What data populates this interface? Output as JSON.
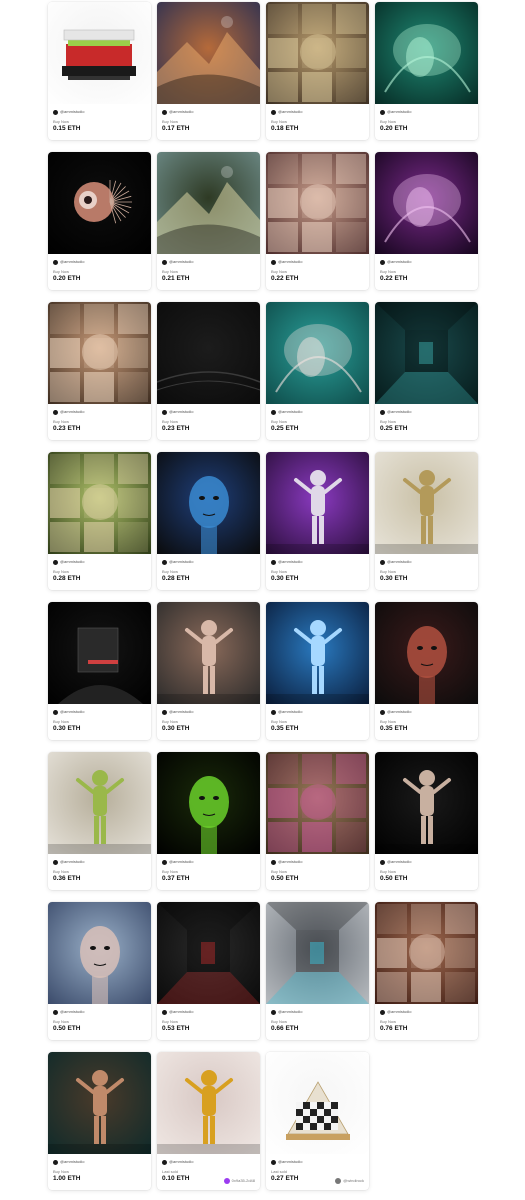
{
  "labels": {
    "buy_now": "Buy Now",
    "last_sold": "Last sold"
  },
  "creator_handle": "@ammistudio",
  "items": [
    {
      "price": "0.15 ETH",
      "status": "Buy Now",
      "art": {
        "bg": [
          "#ffffff",
          "#f2f2f2"
        ],
        "accent": "#d83a3a",
        "kind": "device"
      }
    },
    {
      "price": "0.17 ETH",
      "status": "Buy Now",
      "art": {
        "bg": [
          "#2a2f52",
          "#b56a3a"
        ],
        "accent": "#e8a76a",
        "kind": "landscape"
      }
    },
    {
      "price": "0.18 ETH",
      "status": "Buy Now",
      "art": {
        "bg": [
          "#3b2e22",
          "#b79a6c"
        ],
        "accent": "#e0cfa0",
        "kind": "collage"
      }
    },
    {
      "price": "0.20 ETH",
      "status": "Buy Now",
      "art": {
        "bg": [
          "#062a24",
          "#1f8a74"
        ],
        "accent": "#b6f5d8",
        "kind": "glow"
      }
    },
    {
      "price": "0.20 ETH",
      "status": "Buy Now",
      "art": {
        "bg": [
          "#000000",
          "#0d0d0d"
        ],
        "accent": "#c98c7a",
        "kind": "eye"
      }
    },
    {
      "price": "0.21 ETH",
      "status": "Buy Now",
      "art": {
        "bg": [
          "#6f8d8a",
          "#2e3a24"
        ],
        "accent": "#d8d3a2",
        "kind": "landscape"
      }
    },
    {
      "price": "0.22 ETH",
      "status": "Buy Now",
      "art": {
        "bg": [
          "#4a2a2a",
          "#c59a88"
        ],
        "accent": "#f0d8c8",
        "kind": "collage"
      }
    },
    {
      "price": "0.22 ETH",
      "status": "Buy Now",
      "art": {
        "bg": [
          "#14051c",
          "#7a2a8a"
        ],
        "accent": "#f0c2f0",
        "kind": "glow"
      }
    },
    {
      "price": "0.23 ETH",
      "status": "Buy Now",
      "art": {
        "bg": [
          "#3a2a1e",
          "#c89a78"
        ],
        "accent": "#f3ddc8",
        "kind": "collage"
      }
    },
    {
      "price": "0.23 ETH",
      "status": "Buy Now",
      "art": {
        "bg": [
          "#0b0b0b",
          "#1c1c1c"
        ],
        "accent": "#3a3a3a",
        "kind": "dark"
      }
    },
    {
      "price": "0.25 ETH",
      "status": "Buy Now",
      "art": {
        "bg": [
          "#0e4a48",
          "#2aa09a"
        ],
        "accent": "#f2e3e0",
        "kind": "glow"
      }
    },
    {
      "price": "0.25 ETH",
      "status": "Buy Now",
      "art": {
        "bg": [
          "#061a1a",
          "#1a4a4c"
        ],
        "accent": "#3aa6a6",
        "kind": "room"
      }
    },
    {
      "price": "0.28 ETH",
      "status": "Buy Now",
      "art": {
        "bg": [
          "#2c3a16",
          "#b0c26a"
        ],
        "accent": "#e8d7b0",
        "kind": "collage"
      }
    },
    {
      "price": "0.28 ETH",
      "status": "Buy Now",
      "art": {
        "bg": [
          "#0a0a0a",
          "#1f3f7a"
        ],
        "accent": "#3a8ad0",
        "kind": "head"
      }
    },
    {
      "price": "0.30 ETH",
      "status": "Buy Now",
      "art": {
        "bg": [
          "#2a0e3a",
          "#8a3ac0"
        ],
        "accent": "#e0d8e8",
        "kind": "figure"
      }
    },
    {
      "price": "0.30 ETH",
      "status": "Buy Now",
      "art": {
        "bg": [
          "#e8e4da",
          "#c9c0a6"
        ],
        "accent": "#b39a5a",
        "kind": "figure"
      }
    },
    {
      "price": "0.30 ETH",
      "status": "Buy Now",
      "art": {
        "bg": [
          "#000000",
          "#141414"
        ],
        "accent": "#d04040",
        "kind": "cube"
      }
    },
    {
      "price": "0.30 ETH",
      "status": "Buy Now",
      "art": {
        "bg": [
          "#2a2a2a",
          "#8a6a5a"
        ],
        "accent": "#d8b8a8",
        "kind": "figure"
      }
    },
    {
      "price": "0.35 ETH",
      "status": "Buy Now",
      "art": {
        "bg": [
          "#0a1c3a",
          "#2a7ac0"
        ],
        "accent": "#a6d8ff",
        "kind": "figure"
      }
    },
    {
      "price": "0.35 ETH",
      "status": "Buy Now",
      "art": {
        "bg": [
          "#0b0b0b",
          "#3a1a1a"
        ],
        "accent": "#b05040",
        "kind": "head"
      }
    },
    {
      "price": "0.36 ETH",
      "status": "Buy Now",
      "art": {
        "bg": [
          "#e6e2da",
          "#b6ae9a"
        ],
        "accent": "#9ab84a",
        "kind": "figure"
      }
    },
    {
      "price": "0.37 ETH",
      "status": "Buy Now",
      "art": {
        "bg": [
          "#000000",
          "#1a2a0a"
        ],
        "accent": "#6ad02a",
        "kind": "head"
      }
    },
    {
      "price": "0.50 ETH",
      "status": "Buy Now",
      "art": {
        "bg": [
          "#3a2a1a",
          "#9a7a5a"
        ],
        "accent": "#d05aa0",
        "kind": "collage"
      }
    },
    {
      "price": "0.50 ETH",
      "status": "Buy Now",
      "art": {
        "bg": [
          "#000000",
          "#1a1a1a"
        ],
        "accent": "#c8b0a0",
        "kind": "figure"
      }
    },
    {
      "price": "0.50 ETH",
      "status": "Buy Now",
      "art": {
        "bg": [
          "#3a4a6a",
          "#9ab0c8"
        ],
        "accent": "#d8c0b8",
        "kind": "head"
      }
    },
    {
      "price": "0.53 ETH",
      "status": "Buy Now",
      "art": {
        "bg": [
          "#0a0a0a",
          "#2a2a2a"
        ],
        "accent": "#b02a2a",
        "kind": "room"
      }
    },
    {
      "price": "0.66 ETH",
      "status": "Buy Now",
      "art": {
        "bg": [
          "#b8bcc0",
          "#6a7078"
        ],
        "accent": "#3ac0d8",
        "kind": "room"
      }
    },
    {
      "price": "0.76 ETH",
      "status": "Buy Now",
      "art": {
        "bg": [
          "#3a1a12",
          "#a06a50"
        ],
        "accent": "#e8d0c0",
        "kind": "collage"
      }
    },
    {
      "price": "1.00 ETH",
      "status": "Buy Now",
      "art": {
        "bg": [
          "#0e2a2a",
          "#4a3a2a"
        ],
        "accent": "#c08a6a",
        "kind": "figure"
      }
    },
    {
      "price": "0.10 ETH",
      "status": "Last sold",
      "owner": "0x9a35-2d48",
      "owner_color": "#9b3cf0",
      "art": {
        "bg": [
          "#f0e8e4",
          "#d8c8c4"
        ],
        "accent": "#d8a020",
        "kind": "figure"
      }
    },
    {
      "price": "0.27 ETH",
      "status": "Last sold",
      "owner": "@windirock",
      "owner_color": "#777777",
      "art": {
        "bg": [
          "#ffffff",
          "#f6f6f6"
        ],
        "accent": "#c8a060",
        "kind": "chess"
      }
    }
  ]
}
